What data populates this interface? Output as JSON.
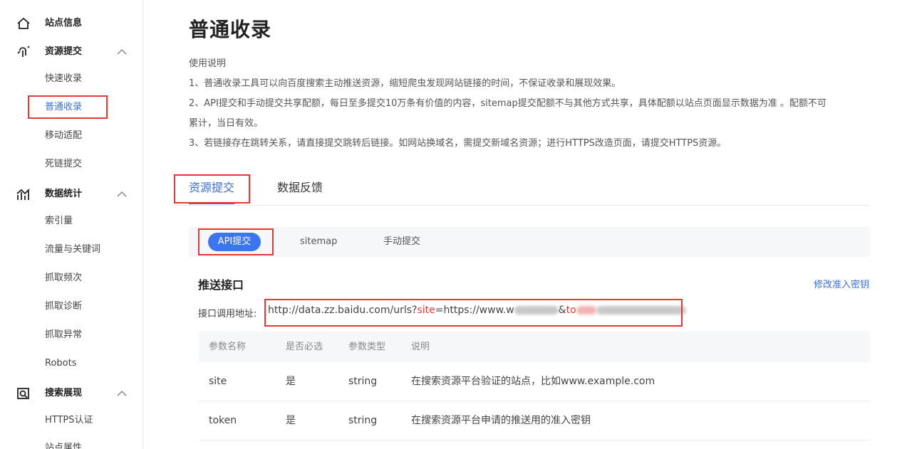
{
  "sidebar": {
    "groups": [
      {
        "label": "站点信息",
        "icon": "home-icon"
      },
      {
        "label": "资源提交",
        "icon": "submit-icon",
        "items": [
          "快速收录",
          "普通收录",
          "移动适配",
          "死链提交"
        ]
      },
      {
        "label": "数据统计",
        "icon": "stats-icon",
        "items": [
          "索引量",
          "流量与关键词",
          "抓取频次",
          "抓取诊断",
          "抓取异常",
          "Robots"
        ]
      },
      {
        "label": "搜索展现",
        "icon": "search-display-icon",
        "items": [
          "HTTPS认证",
          "站点属性"
        ]
      }
    ],
    "active_item": "普通收录"
  },
  "main": {
    "title": "普通收录",
    "usage_title": "使用说明",
    "usage_lines": [
      "1、普通收录工具可以向百度搜索主动推送资源，缩短爬虫发现网站链接的时间，不保证收录和展现效果。",
      "2、API提交和手动提交共享配额，每日至多提交10万条有价值的内容，sitemap提交配额不与其他方式共享，具体配额以站点页面显示数据为准 。配额不可",
      "累计，当日有效。",
      "3、若链接存在跳转关系，请直接提交跳转后链接。如网站换域名，需提交新域名资源；进行HTTPS改造页面，请提交HTTPS资源。"
    ],
    "tabs": [
      "资源提交",
      "数据反馈"
    ],
    "subtabs": [
      "API提交",
      "sitemap",
      "手动提交"
    ],
    "push_title": "推送接口",
    "edit_link": "修改准入密钥",
    "url_label": "接口调用地址:",
    "url": {
      "prefix": "http://data.zz.baidu.com/urls?",
      "site_key": "site",
      "mid": "=https://www.w",
      "amp": "&",
      "token_key": "to"
    },
    "param_table": {
      "headers": [
        "参数名称",
        "是否必选",
        "参数类型",
        "说明"
      ],
      "rows": [
        [
          "site",
          "是",
          "string",
          "在搜索资源平台验证的站点，比如www.example.com"
        ],
        [
          "token",
          "是",
          "string",
          "在搜索资源平台申请的推送用的准入密钥"
        ]
      ]
    }
  },
  "colors": {
    "accent": "#3b76f0",
    "highlight_box": "#e53935"
  }
}
